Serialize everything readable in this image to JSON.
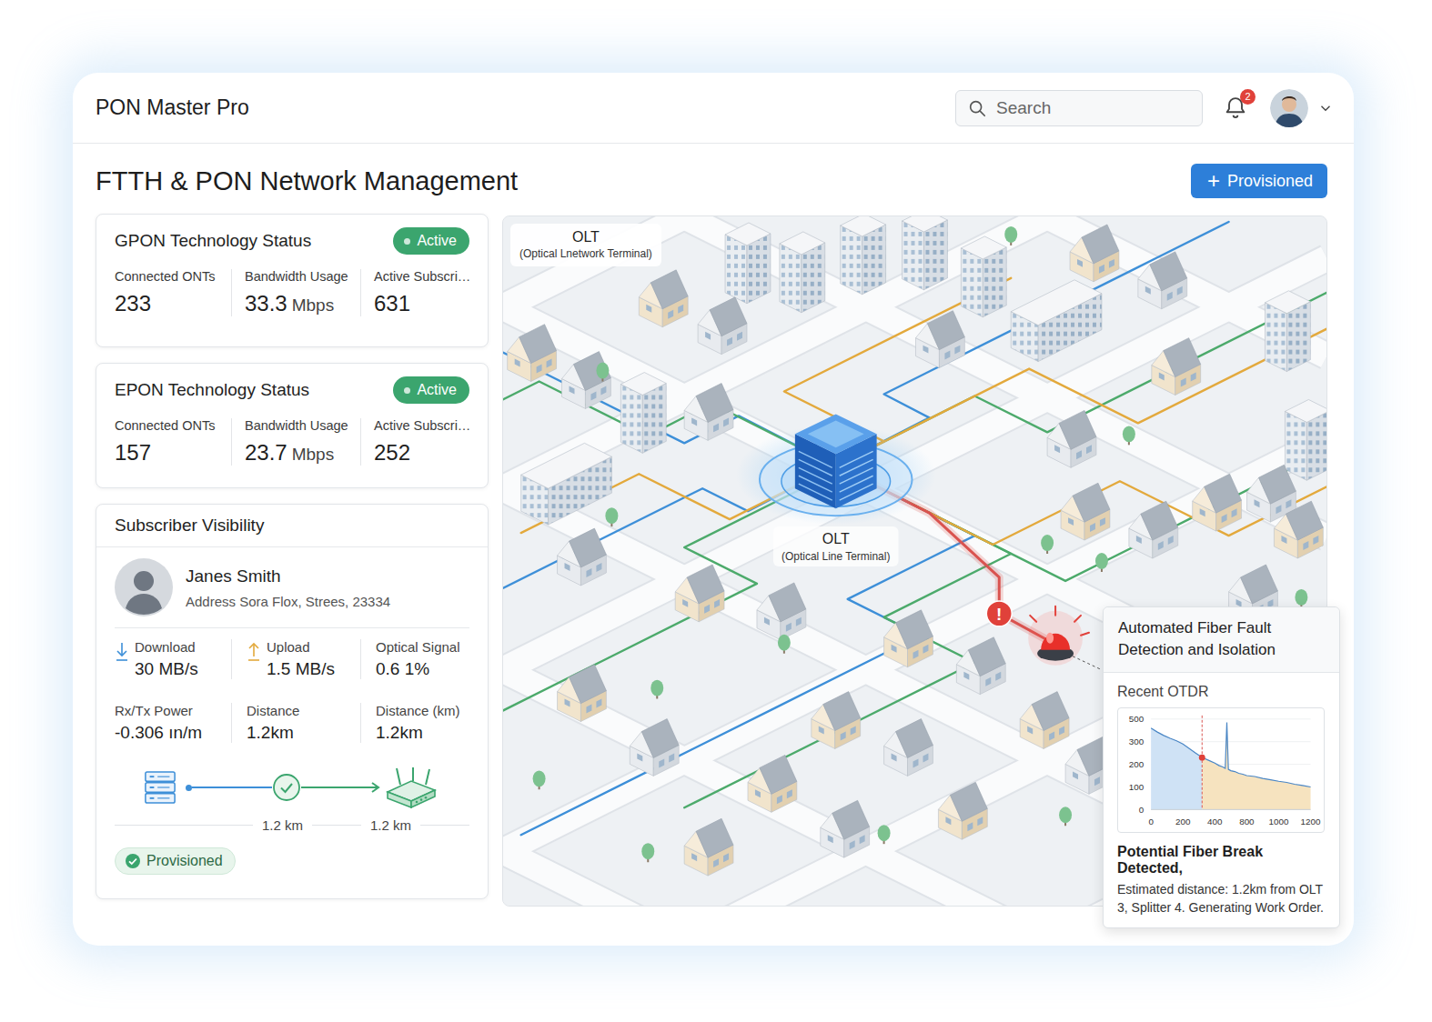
{
  "app": {
    "title": "PON Master Pro"
  },
  "search": {
    "placeholder": "Search"
  },
  "notifications": {
    "count": "2"
  },
  "page": {
    "title": "FTTH & PON Network Management"
  },
  "primary_button": {
    "icon": "+",
    "label": "Provisioned"
  },
  "technologies": [
    {
      "title": "GPON Technology Status",
      "status": "Active",
      "active": true,
      "stats": [
        {
          "label": "Connected ONTs",
          "value": "233"
        },
        {
          "label": "Bandwidth Usage",
          "value": "33.3",
          "unit": "Mbps"
        },
        {
          "label": "Active Subscri…",
          "value": "631"
        }
      ]
    },
    {
      "title": "EPON Technology Status",
      "status": "Active",
      "active": true,
      "stats": [
        {
          "label": "Connected ONTs",
          "value": "157"
        },
        {
          "label": "Bandwidth Usage",
          "value": "23.7",
          "unit": "Mbps"
        },
        {
          "label": "Active Subscri…",
          "value": "252"
        }
      ]
    }
  ],
  "subscriber": {
    "title": "Subscriber Visibility",
    "name": "Janes Smith",
    "address": "Address Sora Flox, Strees, 23334",
    "metrics": [
      {
        "label": "Download",
        "value": "30 MB/s",
        "kind": "download"
      },
      {
        "label": "Upload",
        "value": "1.5 MB/s",
        "kind": "upload"
      },
      {
        "label": "Optical Signal",
        "value": "0.6 1%",
        "kind": "plain"
      },
      {
        "label": "Rx/Tx Power",
        "value": "-0.306 ın/m",
        "kind": "plain"
      },
      {
        "label": "Distance",
        "value": "1.2km",
        "kind": "plain"
      },
      {
        "label": "Distance (km)",
        "value": "1.2km",
        "kind": "plain"
      }
    ],
    "link": {
      "ok": true,
      "distances": [
        "1.2 km",
        "1.2 km"
      ]
    },
    "status": {
      "label": "Provisioned",
      "provisioned": true
    }
  },
  "map": {
    "legend_label": {
      "title": "OLT",
      "subtitle": "(Optical Lnetwork Terminal)"
    },
    "olt": {
      "title": "OLT",
      "subtitle": "(Optical Line Terminal)"
    },
    "fault_marker": "!",
    "alarm_active": true,
    "fibers": [
      {
        "color": "#3d8fd8",
        "faulty": false
      },
      {
        "color": "#4caa6b",
        "faulty": false
      },
      {
        "color": "#e3a93c",
        "faulty": false
      },
      {
        "color": "#d9534f",
        "faulty": true
      }
    ]
  },
  "fault_panel": {
    "title": "Automated Fiber Fault Detection and Isolation",
    "chart": {
      "title": "Recent OTDR",
      "y_ticks": [
        "500",
        "300",
        "200",
        "100",
        "0"
      ],
      "x_ticks": [
        "0",
        "200",
        "400",
        "800",
        "1000",
        "1200"
      ],
      "trace": {
        "x": [
          0,
          40,
          80,
          120,
          160,
          200,
          240,
          280,
          320,
          360,
          400,
          450,
          500,
          530,
          550,
          570,
          600,
          650,
          700,
          750,
          800,
          850,
          900,
          950,
          1000,
          1050,
          1100,
          1150,
          1200
        ],
        "y": [
          420,
          385,
          355,
          330,
          308,
          290,
          270,
          250,
          230,
          218,
          205,
          195,
          188,
          182,
          470,
          178,
          172,
          168,
          160,
          156,
          150,
          146,
          138,
          132,
          125,
          120,
          112,
          106,
          100
        ]
      },
      "break_point": {
        "x": 320,
        "y": 230
      }
    },
    "alert_title": "Potential Fiber Break Detected,",
    "alert_text": "Estimated distance: 1.2km from OLT 3, Splitter 4. Generating Work Order."
  }
}
